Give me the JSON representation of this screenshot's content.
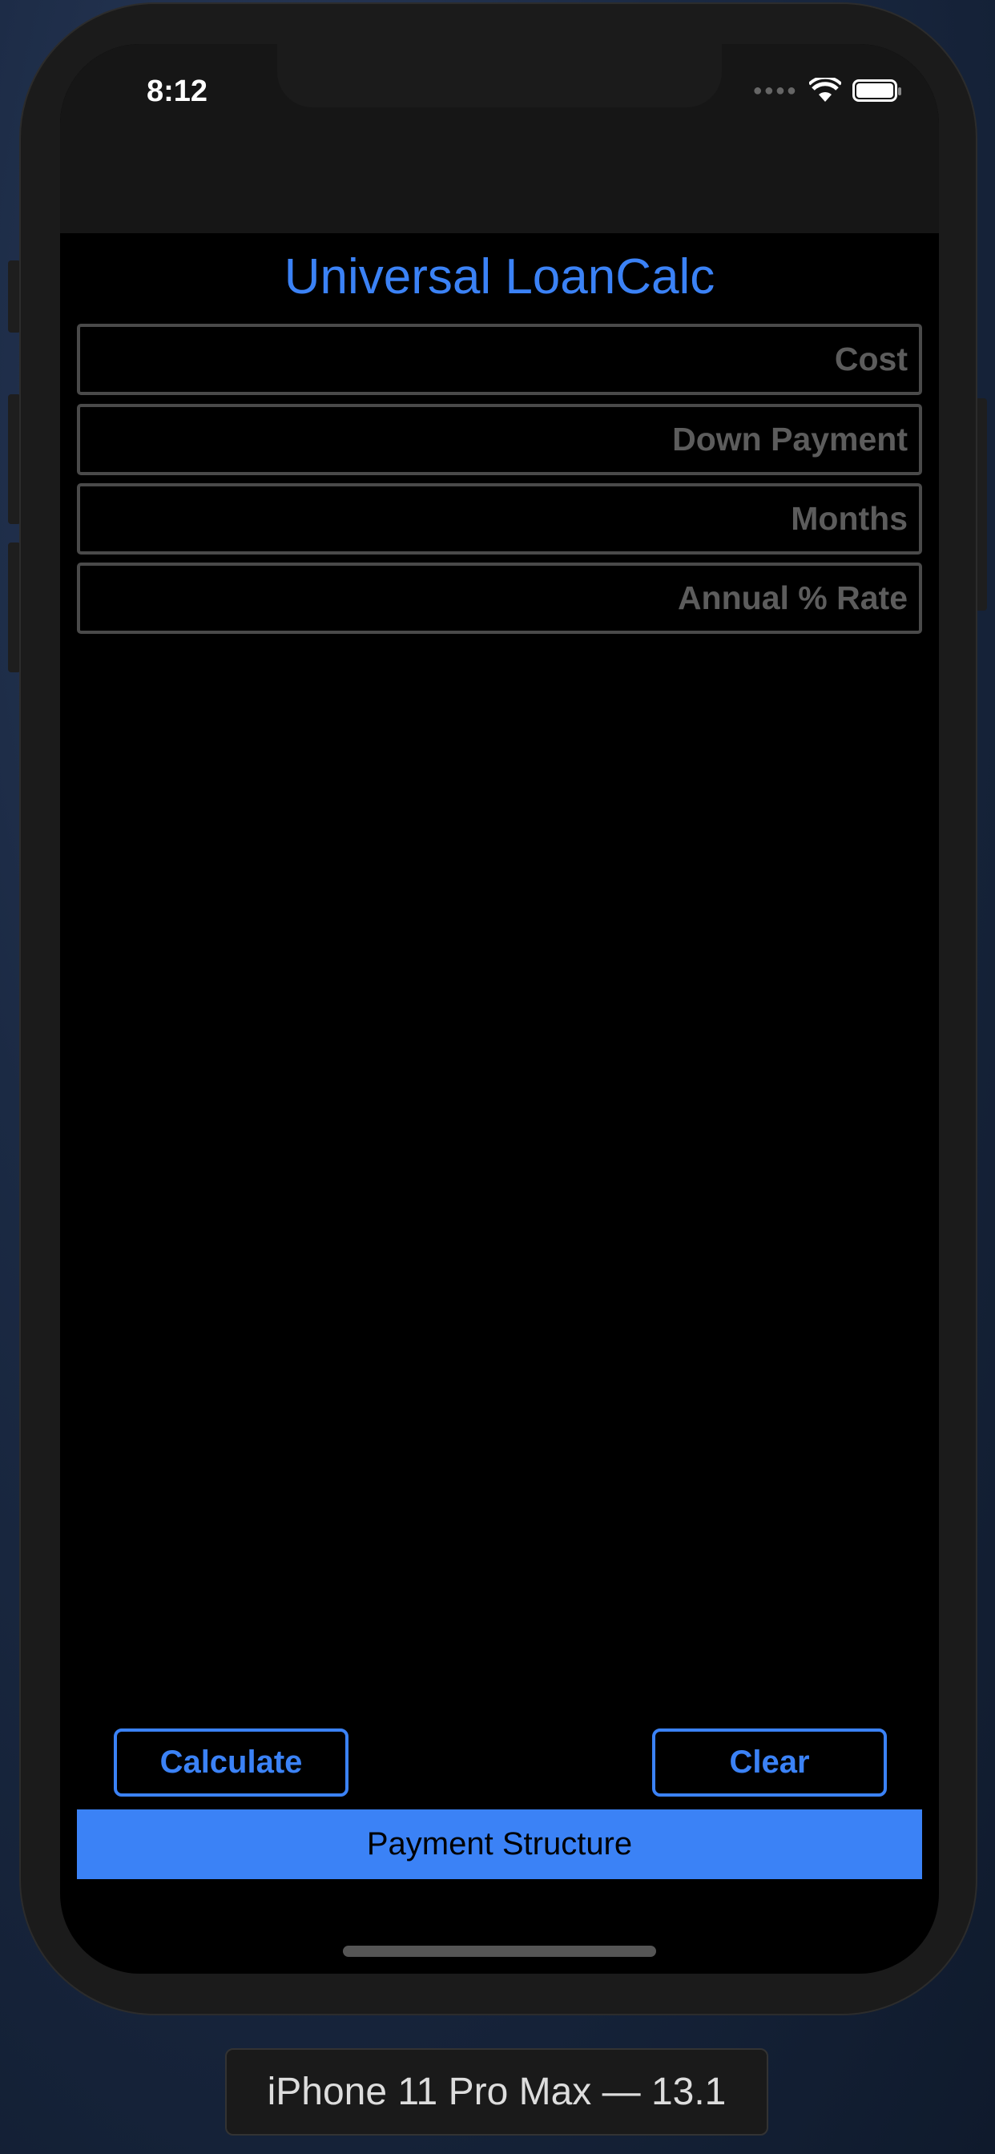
{
  "status_bar": {
    "time": "8:12"
  },
  "app": {
    "title": "Universal LoanCalc"
  },
  "fields": [
    {
      "placeholder": "Cost",
      "value": ""
    },
    {
      "placeholder": "Down Payment",
      "value": ""
    },
    {
      "placeholder": "Months",
      "value": ""
    },
    {
      "placeholder": "Annual % Rate",
      "value": ""
    }
  ],
  "buttons": {
    "calculate": "Calculate",
    "clear": "Clear",
    "payment_structure": "Payment Structure"
  },
  "simulator": {
    "device_label": "iPhone 11 Pro Max — 13.1"
  },
  "colors": {
    "accent": "#3b82f6",
    "background": "#000000"
  }
}
